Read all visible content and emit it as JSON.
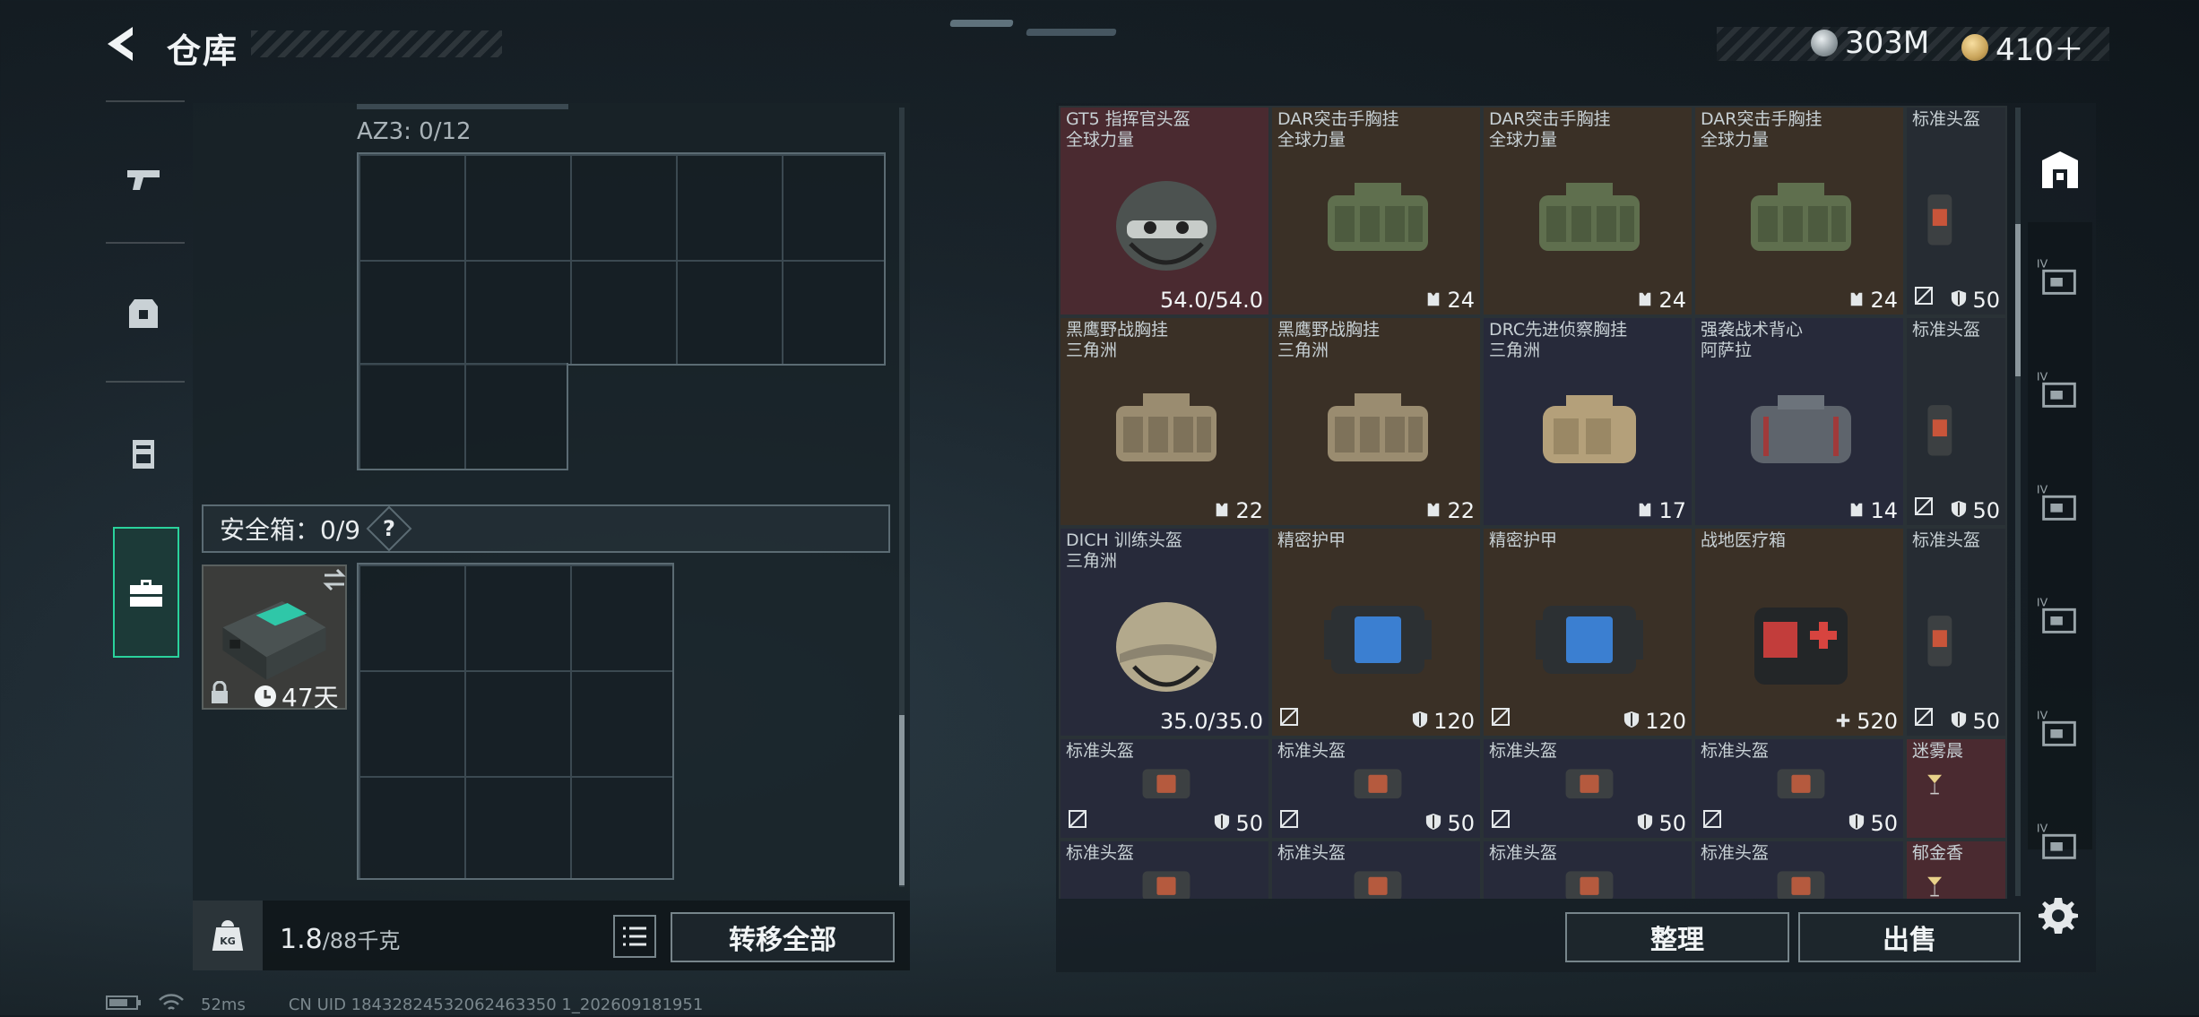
{
  "header": {
    "title": "仓库"
  },
  "currency": [
    {
      "name": "silver-coin-icon",
      "amount": "303M",
      "color": "#9aa3a8"
    },
    {
      "name": "gold-coin-icon",
      "amount": "410＋",
      "color": "#c9a45a"
    }
  ],
  "left": {
    "container_label": "AZ3: 0/12",
    "safe_label": "安全箱：0/9",
    "safe_help": "?",
    "safe_days": "47天",
    "weight_value": "1.8",
    "weight_cap": "/88千克",
    "transfer_all": "转移全部"
  },
  "items": [
    {
      "name1": "GT5 指挥官头盔",
      "name2": "全球力量",
      "value": "54.0/54.0",
      "icon": "helmet",
      "bg": "#4a2a30"
    },
    {
      "name1": "DAR突击手胸挂",
      "name2": "全球力量",
      "value": "24",
      "icon": "vest-green",
      "bg": "#3a3026",
      "vicon": "vest"
    },
    {
      "name1": "DAR突击手胸挂",
      "name2": "全球力量",
      "value": "24",
      "icon": "vest-green",
      "bg": "#3a3026",
      "vicon": "vest"
    },
    {
      "name1": "DAR突击手胸挂",
      "name2": "全球力量",
      "value": "24",
      "icon": "vest-green",
      "bg": "#3a3026",
      "vicon": "vest"
    },
    {
      "name1": "标准头盔",
      "name2": "",
      "value": "50",
      "icon": "armor-slim",
      "bg": "#262c33",
      "vicon": "shield",
      "broken": true
    },
    {
      "name1": "黑鹰野战胸挂",
      "name2": "三角洲",
      "value": "22",
      "icon": "vest-tan",
      "bg": "#3a3026",
      "vicon": "vest"
    },
    {
      "name1": "黑鹰野战胸挂",
      "name2": "三角洲",
      "value": "22",
      "icon": "vest-tan",
      "bg": "#3a3026",
      "vicon": "vest"
    },
    {
      "name1": "DRC先进侦察胸挂",
      "name2": "三角洲",
      "value": "17",
      "icon": "vest-khaki",
      "bg": "#272a3a",
      "vicon": "vest"
    },
    {
      "name1": "强袭战术背心",
      "name2": "阿萨拉",
      "value": "14",
      "icon": "vest-grey",
      "bg": "#272a3a",
      "vicon": "vest"
    },
    {
      "name1": "标准头盔",
      "name2": "",
      "value": "50",
      "icon": "armor-slim",
      "bg": "#262c33",
      "vicon": "shield",
      "broken": true
    },
    {
      "name1": "DICH 训练头盔",
      "name2": "三角洲",
      "value": "35.0/35.0",
      "icon": "helmet-tan",
      "bg": "#272a3a"
    },
    {
      "name1": "精密护甲",
      "name2": "",
      "value": "120",
      "icon": "armor-blue",
      "bg": "#3a3026",
      "vicon": "shield",
      "broken": true
    },
    {
      "name1": "精密护甲",
      "name2": "",
      "value": "120",
      "icon": "armor-blue",
      "bg": "#3a3026",
      "vicon": "shield",
      "broken": true
    },
    {
      "name1": "战地医疗箱",
      "name2": "",
      "value": "520",
      "icon": "medkit",
      "bg": "#3a3026",
      "vicon": "plus"
    },
    {
      "name1": "标准头盔",
      "name2": "",
      "value": "50",
      "icon": "armor-slim",
      "bg": "#262c33",
      "vicon": "shield",
      "broken": true
    },
    {
      "name1": "标准头盔",
      "name2": "",
      "value": "50",
      "icon": "armor-wide",
      "bg": "#272a3a",
      "vicon": "shield",
      "broken": true
    },
    {
      "name1": "标准头盔",
      "name2": "",
      "value": "50",
      "icon": "armor-wide",
      "bg": "#272a3a",
      "vicon": "shield",
      "broken": true
    },
    {
      "name1": "标准头盔",
      "name2": "",
      "value": "50",
      "icon": "armor-wide",
      "bg": "#272a3a",
      "vicon": "shield",
      "broken": true
    },
    {
      "name1": "标准头盔",
      "name2": "",
      "value": "50",
      "icon": "armor-wide",
      "bg": "#272a3a",
      "vicon": "shield",
      "broken": true
    },
    {
      "name1": "迷雾晨",
      "name2": "",
      "value": "",
      "icon": "cocktail",
      "bg": "#4a2a30"
    },
    {
      "name1": "标准头盔",
      "name2": "",
      "value": "",
      "icon": "armor-wide",
      "bg": "#272a3a"
    },
    {
      "name1": "标准头盔",
      "name2": "",
      "value": "",
      "icon": "armor-wide",
      "bg": "#272a3a"
    },
    {
      "name1": "标准头盔",
      "name2": "",
      "value": "",
      "icon": "armor-wide",
      "bg": "#272a3a"
    },
    {
      "name1": "标准头盔",
      "name2": "",
      "value": "",
      "icon": "armor-wide",
      "bg": "#272a3a"
    },
    {
      "name1": "郁金香",
      "name2": "",
      "value": "",
      "icon": "cocktail",
      "bg": "#4a2a30"
    }
  ],
  "actions": {
    "organize": "整理",
    "sell": "出售"
  },
  "status": {
    "ping": "52ms",
    "uid": "CN UID 18432824532062463350 1_202609181951"
  }
}
